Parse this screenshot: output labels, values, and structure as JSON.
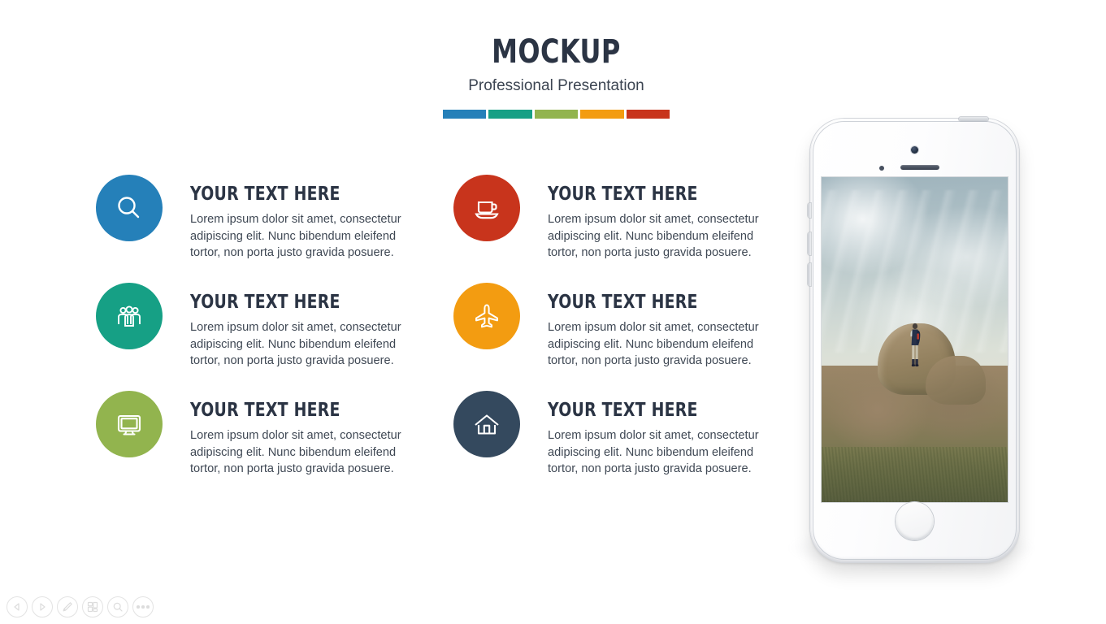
{
  "header": {
    "title": "MOCKUP",
    "subtitle": "Professional Presentation",
    "color_bar": [
      {
        "name": "blue",
        "color": "#2580b9"
      },
      {
        "name": "teal",
        "color": "#16a085"
      },
      {
        "name": "green",
        "color": "#92b44e"
      },
      {
        "name": "orange",
        "color": "#f39c11"
      },
      {
        "name": "red",
        "color": "#c8341c"
      }
    ]
  },
  "features": {
    "left": [
      {
        "icon": "search-icon",
        "color": "#2580b9",
        "heading": "YOUR TEXT HERE",
        "text": "Lorem ipsum dolor sit amet, consectetur adipiscing elit. Nunc bibendum eleifend tortor, non porta justo gravida posuere."
      },
      {
        "icon": "users-group-icon",
        "color": "#16a085",
        "heading": "YOUR TEXT HERE",
        "text": "Lorem ipsum dolor sit amet, consectetur adipiscing elit. Nunc bibendum eleifend tortor, non porta justo gravida posuere."
      },
      {
        "icon": "monitor-icon",
        "color": "#92b44e",
        "heading": "YOUR TEXT HERE",
        "text": "Lorem ipsum dolor sit amet, consectetur adipiscing elit. Nunc bibendum eleifend tortor, non porta justo gravida posuere."
      }
    ],
    "right": [
      {
        "icon": "coffee-cup-icon",
        "color": "#c8341c",
        "heading": "YOUR TEXT HERE",
        "text": "Lorem ipsum dolor sit amet, consectetur adipiscing elit. Nunc bibendum eleifend tortor, non porta justo gravida posuere."
      },
      {
        "icon": "airplane-icon",
        "color": "#f39c11",
        "heading": "YOUR TEXT HERE",
        "text": "Lorem ipsum dolor sit amet, consectetur adipiscing elit. Nunc bibendum eleifend tortor, non porta justo gravida posuere."
      },
      {
        "icon": "home-icon",
        "color": "#34495e",
        "heading": "YOUR TEXT HERE",
        "text": "Lorem ipsum dolor sit amet, consectetur adipiscing elit. Nunc bibendum eleifend tortor, non porta justo gravida posuere."
      }
    ]
  },
  "phone_mockup": {
    "device": "white-smartphone",
    "screen_photo": "hiker-with-backpack-standing-on-rocky-summit-under-cloudy-sky"
  },
  "toolbar": {
    "buttons": [
      {
        "name": "previous-slide-button",
        "icon": "triangle-left-icon"
      },
      {
        "name": "next-slide-button",
        "icon": "triangle-right-icon"
      },
      {
        "name": "pen-tool-button",
        "icon": "pen-icon"
      },
      {
        "name": "slides-overview-button",
        "icon": "slides-icon"
      },
      {
        "name": "zoom-button",
        "icon": "magnifier-icon"
      },
      {
        "name": "more-options-button",
        "icon": "ellipsis-icon"
      }
    ]
  }
}
